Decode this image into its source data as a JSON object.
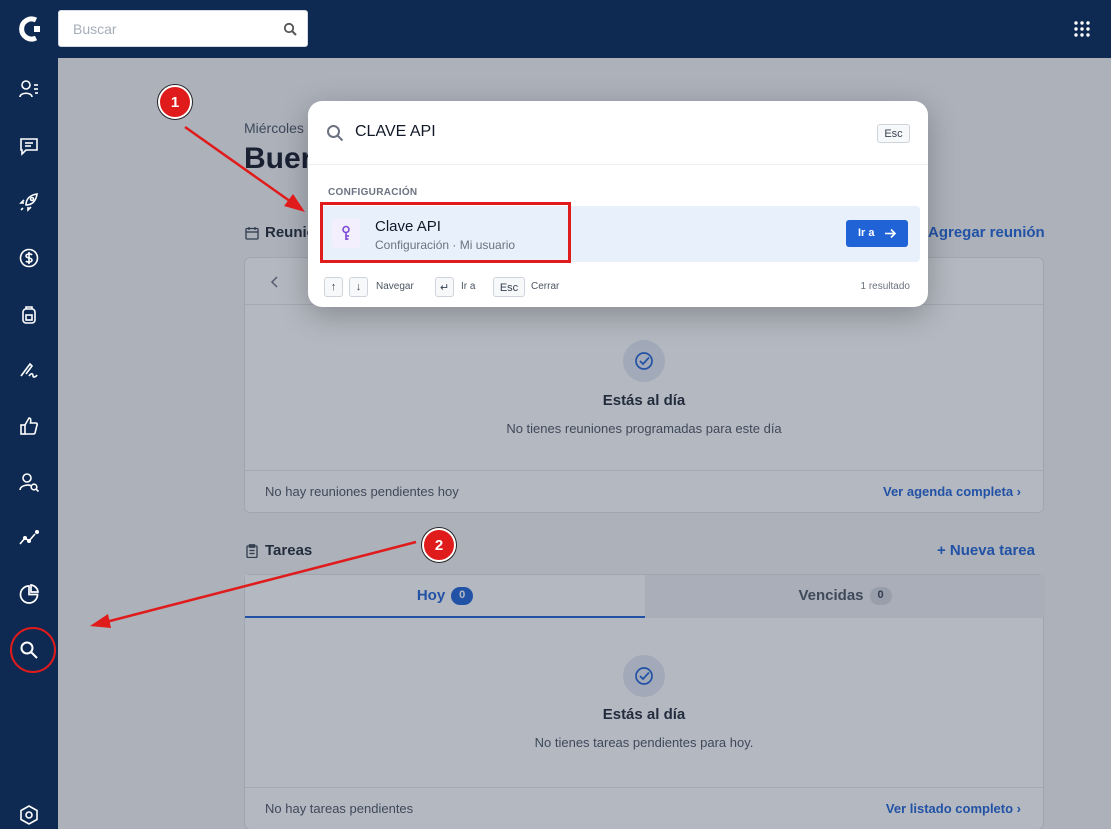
{
  "topbar": {
    "search_placeholder": "Buscar"
  },
  "main": {
    "date": "Miércoles",
    "greeting": "Buer",
    "meetings": {
      "title": "Reunio",
      "add_label": "Agregar reunión",
      "empty_title": "Estás al día",
      "empty_sub": "No tienes reuniones programadas para este día",
      "footer_left": "No hay reuniones pendientes hoy",
      "footer_right": "Ver agenda completa ›"
    },
    "tasks": {
      "title": "Tareas",
      "add_label": "+ Nueva tarea",
      "tabs": [
        {
          "label": "Hoy",
          "count": "0"
        },
        {
          "label": "Vencidas",
          "count": "0"
        }
      ],
      "empty_title": "Estás al día",
      "empty_sub": "No tienes tareas pendientes para hoy.",
      "footer_left": "No hay tareas pendientes",
      "footer_right": "Ver listado completo ›"
    }
  },
  "modal": {
    "query": "CLAVE API",
    "esc_key": "Esc",
    "category": "CONFIGURACIÓN",
    "result": {
      "title": "Clave API",
      "subtitle": "Configuración · Mi usuario",
      "go_label": "Ir a"
    },
    "footer": {
      "up_key": "↑",
      "down_key": "↓",
      "navigate": "Navegar",
      "enter_key": "↵",
      "go": "Ir a",
      "esc_key": "Esc",
      "close": "Cerrar",
      "count": "1 resultado"
    }
  },
  "annotations": {
    "callout_1": "1",
    "callout_2": "2",
    "color": "#e01b1b"
  },
  "colors": {
    "sidebar": "#0f2a52",
    "accent": "#1f63d6"
  }
}
